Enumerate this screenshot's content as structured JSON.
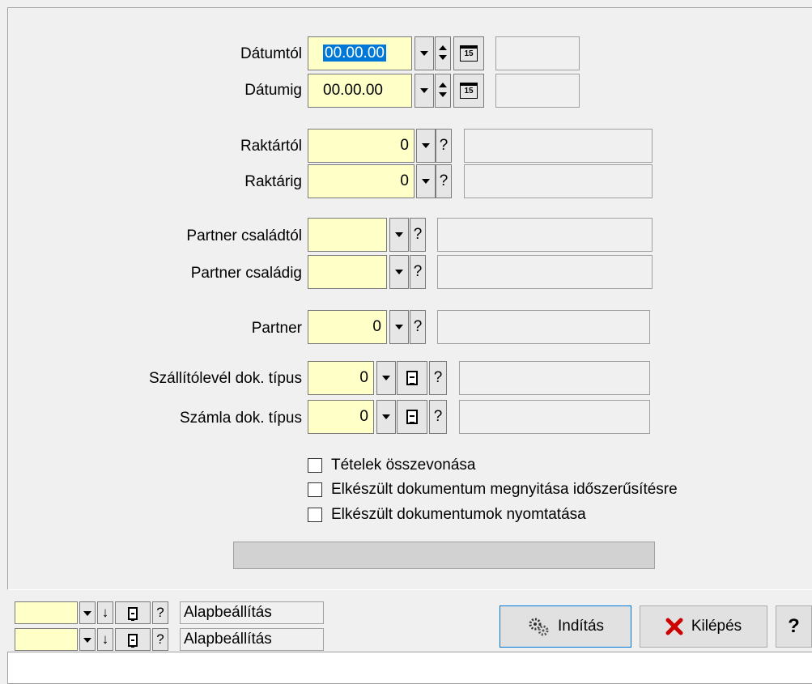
{
  "form": {
    "date_from_label": "Dátumtól",
    "date_from_value": "00.00.00",
    "date_to_label": "Dátumig",
    "date_to_value": "00.00.00",
    "calendar_day": "15",
    "warehouse_from_label": "Raktártól",
    "warehouse_from_value": "0",
    "warehouse_to_label": "Raktárig",
    "warehouse_to_value": "0",
    "partner_family_from_label": "Partner családtól",
    "partner_family_to_label": "Partner családig",
    "partner_label": "Partner",
    "partner_value": "0",
    "delivery_note_type_label": "Szállítólevél dok. típus",
    "delivery_note_type_value": "0",
    "invoice_type_label": "Számla dok. típus",
    "invoice_type_value": "0",
    "help_glyph": "?"
  },
  "options": {
    "merge_items": "Tételek összevonása",
    "open_for_update": "Elkészült dokumentum megnyitása időszerűsítésre",
    "print_documents": "Elkészült dokumentumok nyomtatása"
  },
  "bottom": {
    "preset1_label": "Alapbeállítás",
    "preset2_label": "Alapbeállítás",
    "down_arrow": "↓",
    "start_label": "Indítás",
    "exit_label": "Kilépés",
    "help_label": "?"
  },
  "colors": {
    "input_bg": "#ffffc8",
    "selection": "#0078d7",
    "exit_icon": "#cc0000"
  }
}
